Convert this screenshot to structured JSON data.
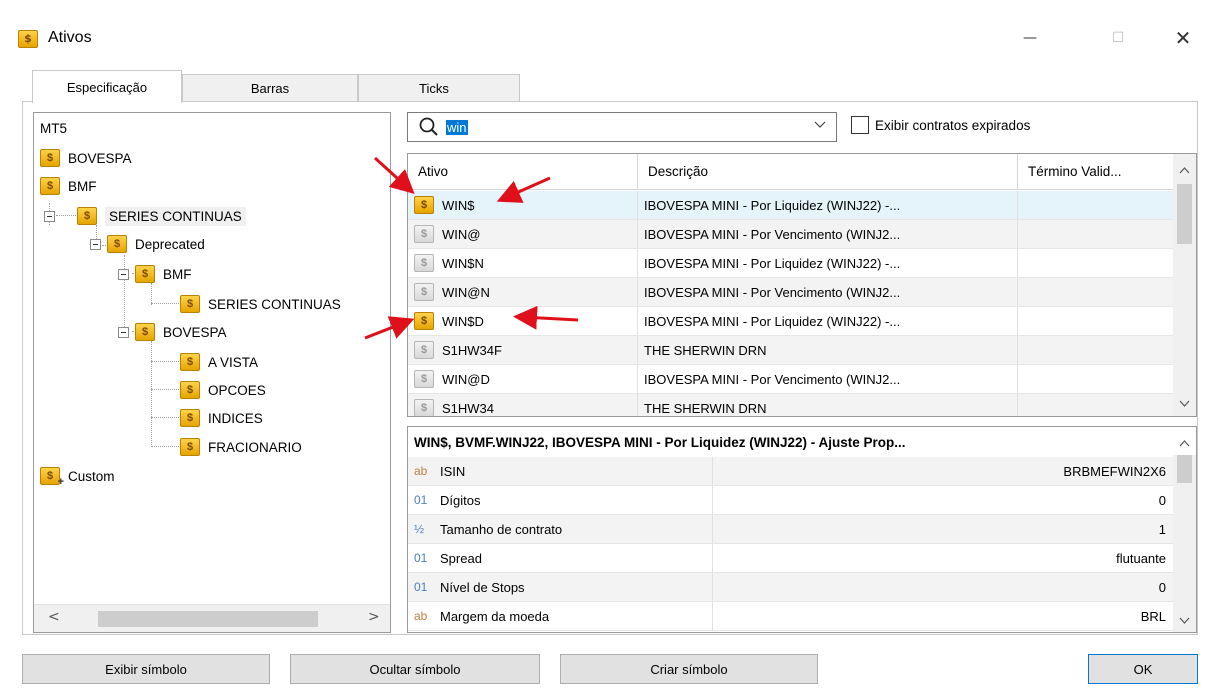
{
  "window": {
    "title": "Ativos",
    "minimize": "—",
    "maximize": "☐",
    "close": "✕"
  },
  "tabs": [
    {
      "label": "Especificação",
      "active": true
    },
    {
      "label": "Barras",
      "active": false
    },
    {
      "label": "Ticks",
      "active": false
    }
  ],
  "tree": {
    "root": "MT5",
    "items": {
      "bovespa": "BOVESPA",
      "bmf": "BMF",
      "series_continuas": "SERIES CONTINUAS",
      "deprecated": "Deprecated",
      "dep_bmf": "BMF",
      "dep_bmf_series": "SERIES CONTINUAS",
      "dep_bovespa": "BOVESPA",
      "a_vista": "A VISTA",
      "opcoes": "OPCOES",
      "indices": "INDICES",
      "fracionario": "FRACIONARIO",
      "custom": "Custom"
    },
    "scroll_left": "<",
    "scroll_right": ">"
  },
  "search": {
    "value": "win",
    "dropdown": "⌄",
    "show_expired_label": "Exibir contratos expirados",
    "show_expired_checked": false
  },
  "symbols": {
    "columns": [
      "Ativo",
      "Descrição",
      "Término Valid..."
    ],
    "rows": [
      {
        "ativo": "WIN$",
        "descricao": "IBOVESPA MINI - Por Liquidez (WINJ22) -...",
        "active": true
      },
      {
        "ativo": "WIN@",
        "descricao": "IBOVESPA MINI - Por Vencimento (WINJ2...",
        "active": false
      },
      {
        "ativo": "WIN$N",
        "descricao": "IBOVESPA MINI - Por Liquidez (WINJ22) -...",
        "active": false
      },
      {
        "ativo": "WIN@N",
        "descricao": "IBOVESPA MINI - Por Vencimento (WINJ2...",
        "active": false
      },
      {
        "ativo": "WIN$D",
        "descricao": "IBOVESPA MINI - Por Liquidez (WINJ22) -...",
        "active": true
      },
      {
        "ativo": "S1HW34F",
        "descricao": "THE SHERWIN DRN",
        "active": false
      },
      {
        "ativo": "WIN@D",
        "descricao": "IBOVESPA MINI - Por Vencimento (WINJ2...",
        "active": false
      },
      {
        "ativo": "S1HW34",
        "descricao": "THE SHERWIN DRN",
        "active": false
      }
    ]
  },
  "properties": {
    "title": "WIN$, BVMF.WINJ22, IBOVESPA MINI - Por Liquidez (WINJ22) - Ajuste Prop...",
    "rows": [
      {
        "icon": "ab",
        "name": "ISIN",
        "value": "BRBMEFWIN2X6"
      },
      {
        "icon": "01",
        "name": "Dígitos",
        "value": "0"
      },
      {
        "icon": "½",
        "name": "Tamanho de contrato",
        "value": "1"
      },
      {
        "icon": "01",
        "name": "Spread",
        "value": "flutuante"
      },
      {
        "icon": "01",
        "name": "Nível de Stops",
        "value": "0"
      },
      {
        "icon": "ab",
        "name": "Margem da moeda",
        "value": "BRL"
      }
    ]
  },
  "buttons": {
    "show_symbol": "Exibir símbolo",
    "hide_symbol": "Ocultar símbolo",
    "create_symbol": "Criar símbolo",
    "ok": "OK"
  },
  "colors": {
    "accent": "#0078d7",
    "annotation_arrow": "#e0101a",
    "coin": "#f2b400"
  }
}
